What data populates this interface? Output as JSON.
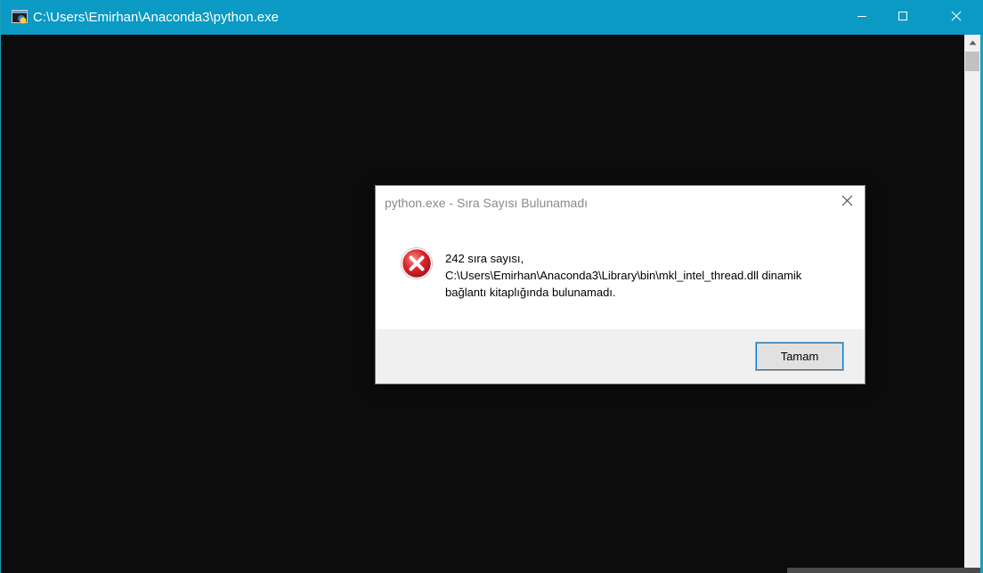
{
  "window": {
    "title": "C:\\Users\\Emirhan\\Anaconda3\\python.exe",
    "icon": "console-app-icon",
    "controls": [
      "minimize-icon",
      "maximize-icon",
      "close-icon"
    ],
    "accent_color": "#0a9ac4",
    "console_background": "#0c0c0c"
  },
  "dialog": {
    "title": "python.exe - Sıra Sayısı Bulunamadı",
    "icon": "error-icon",
    "message_lines": [
      "242 sıra sayısı,",
      "C:\\Users\\Emirhan\\Anaconda3\\Library\\bin\\mkl_intel_thread.dll dinamik",
      "bağlantı kitaplığında bulunamadı."
    ],
    "ok_label": "Tamam",
    "error_color": "#d9262c"
  }
}
